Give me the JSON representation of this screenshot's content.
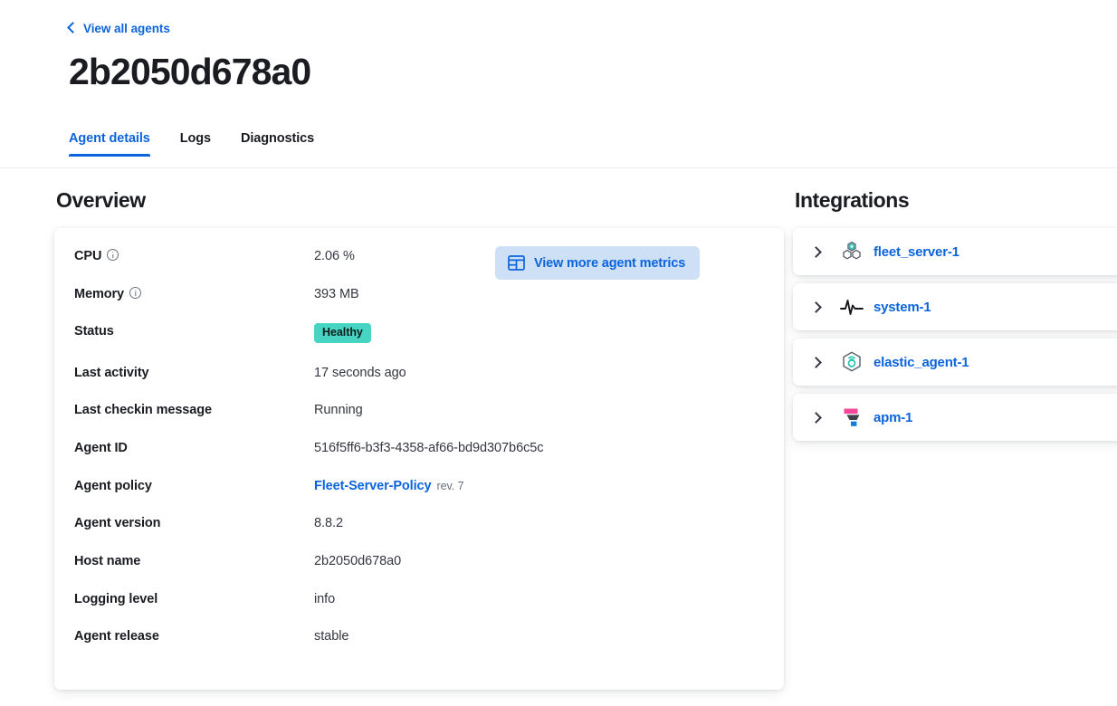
{
  "header": {
    "back_link": "View all agents",
    "back_icon": "chevron-left-icon",
    "title": "2b2050d678a0",
    "tabs": [
      {
        "label": "Agent details",
        "active": true
      },
      {
        "label": "Logs",
        "active": false
      },
      {
        "label": "Diagnostics",
        "active": false
      }
    ]
  },
  "overview": {
    "section_title": "Overview",
    "metrics_button": {
      "label": "View more agent metrics",
      "icon": "dashboard-grid-icon"
    },
    "rows": [
      {
        "key": "CPU",
        "value": "2.06 %",
        "info": true,
        "type": "text"
      },
      {
        "key": "Memory",
        "value": "393 MB",
        "info": true,
        "type": "text"
      },
      {
        "key": "Status",
        "value": "Healthy",
        "info": false,
        "type": "badge"
      },
      {
        "key": "Last activity",
        "value": "17 seconds ago",
        "info": false,
        "type": "text"
      },
      {
        "key": "Last checkin message",
        "value": "Running",
        "info": false,
        "type": "text"
      },
      {
        "key": "Agent ID",
        "value": "516f5ff6-b3f3-4358-af66-bd9d307b6c5c",
        "info": false,
        "type": "text"
      },
      {
        "key": "Agent policy",
        "value": "Fleet-Server-Policy",
        "revision": "rev. 7",
        "info": false,
        "type": "link"
      },
      {
        "key": "Agent version",
        "value": "8.8.2",
        "info": false,
        "type": "text"
      },
      {
        "key": "Host name",
        "value": "2b2050d678a0",
        "info": false,
        "type": "text"
      },
      {
        "key": "Logging level",
        "value": "info",
        "info": false,
        "type": "text"
      },
      {
        "key": "Agent release",
        "value": "stable",
        "info": false,
        "type": "text"
      }
    ]
  },
  "integrations": {
    "section_title": "Integrations",
    "items": [
      {
        "name": "fleet_server-1",
        "icon": "hexagon-cluster-icon",
        "expand_icon": "chevron-right-icon"
      },
      {
        "name": "system-1",
        "icon": "pulse-heartbeat-icon",
        "expand_icon": "chevron-right-icon"
      },
      {
        "name": "elastic_agent-1",
        "icon": "agent-hexagon-icon",
        "expand_icon": "chevron-right-icon"
      },
      {
        "name": "apm-1",
        "icon": "apm-funnel-icon",
        "expand_icon": "chevron-right-icon"
      }
    ]
  },
  "colors": {
    "link": "#0b64dd",
    "badge_healthy": "#48d4c3",
    "text_primary": "#1a1c21",
    "text_secondary": "#343741",
    "button_bg": "#cde0f5",
    "accent_teal": "#22c3b5",
    "apm_pink": "#f5469b",
    "apm_blue": "#0b7fdb"
  }
}
